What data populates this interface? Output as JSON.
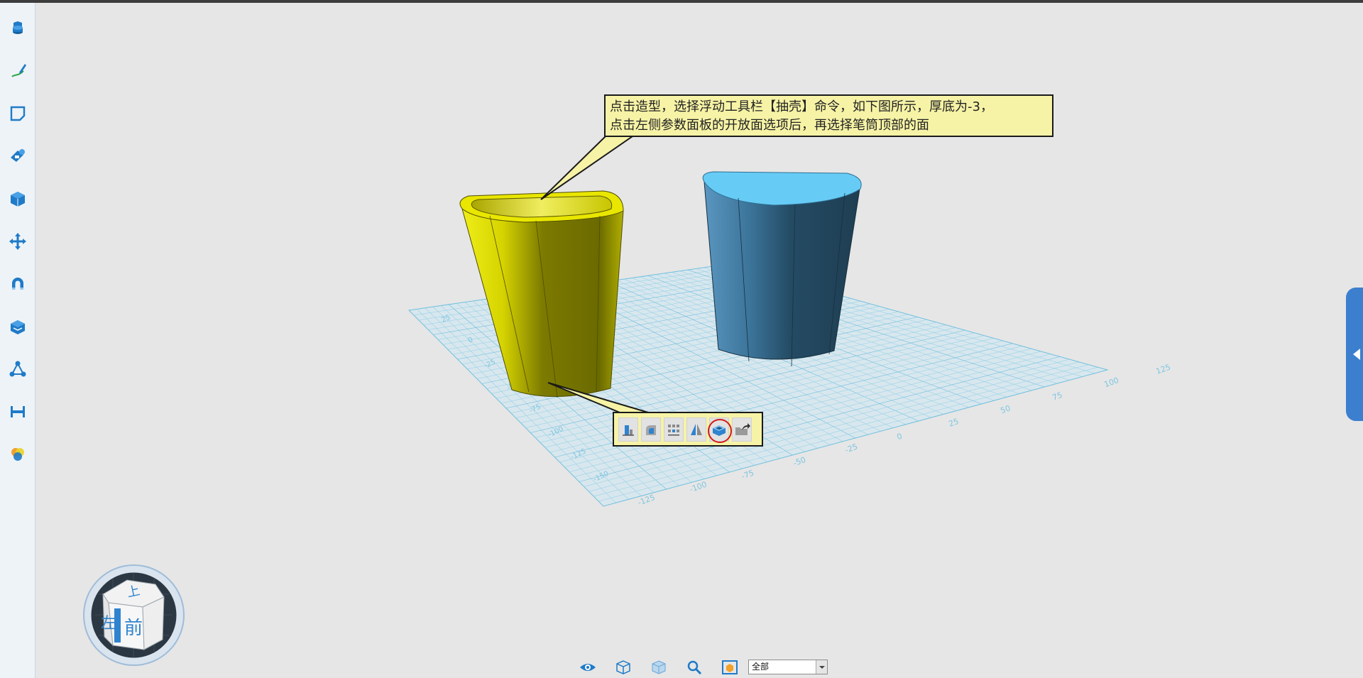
{
  "sidebar": {
    "items": [
      {
        "name": "basic-shapes"
      },
      {
        "name": "sketch-draw"
      },
      {
        "name": "edit-sketch"
      },
      {
        "name": "feature-modeling"
      },
      {
        "name": "special-function"
      },
      {
        "name": "basic-edit"
      },
      {
        "name": "magnet"
      },
      {
        "name": "combine"
      },
      {
        "name": "group"
      },
      {
        "name": "measure"
      },
      {
        "name": "material-render"
      }
    ]
  },
  "callout": {
    "line1": "点击造型，选择浮动工具栏【抽壳】命令，如下图所示，厚底为-3，",
    "line2": "点击左侧参数面板的开放面选项后，再选择笔筒顶部的面"
  },
  "float_toolbar": {
    "buttons": [
      "extrude-icon",
      "fillet-icon",
      "array-icon",
      "mirror-icon",
      "shell-icon",
      "export-icon"
    ],
    "highlighted": "shell-icon",
    "highlight_color": "#d21a1a"
  },
  "grid": {
    "front_ticks": [
      "-125",
      "-100",
      "-75",
      "-50",
      "-25",
      "0",
      "25",
      "50",
      "75",
      "100",
      "125"
    ],
    "left_ticks": [
      "-150",
      "-125",
      "-100",
      "-75",
      "-50",
      "-25",
      "0",
      "25"
    ]
  },
  "viewcube": {
    "top": "上",
    "left": "左",
    "front": "前"
  },
  "bottom_bar": {
    "icons": [
      "eye-icon",
      "wireframe-cube-icon",
      "shaded-cube-icon",
      "zoom-icon",
      "fit-view-icon"
    ],
    "filter_value": "全部"
  },
  "colors": {
    "accent": "#1f7bc8",
    "yellow_object": "#e3e000",
    "blue_object": "#4a8bb0",
    "grid": "#7fc6e0",
    "callout_bg": "#f6f3a6"
  }
}
